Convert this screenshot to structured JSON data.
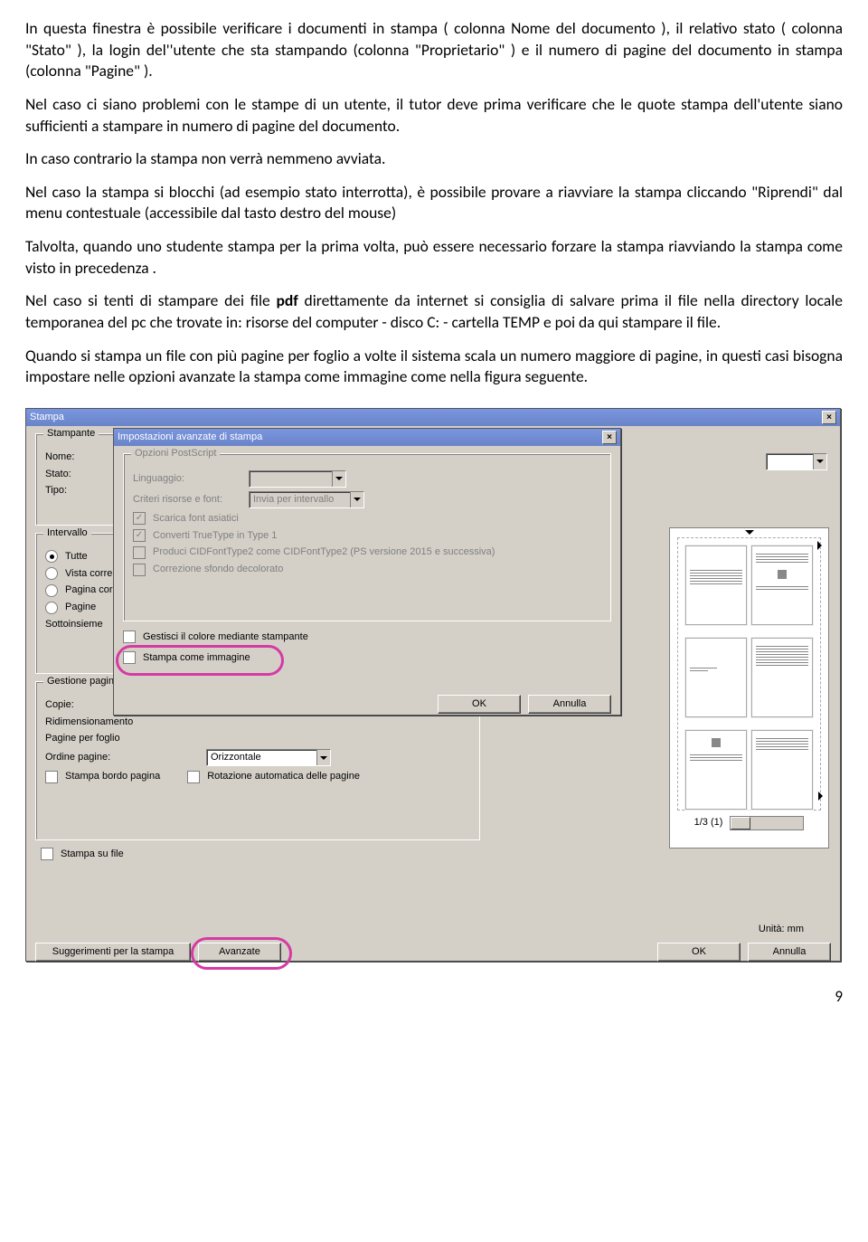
{
  "paragraphs": {
    "p1": "In questa finestra è possibile verificare i documenti in stampa ( colonna Nome del documento ), il relativo stato ( colonna \"Stato\" ), la login del''utente che sta stampando (colonna \"Proprietario\" ) e il numero di pagine del documento in stampa (colonna \"Pagine\" ).",
    "p2": "Nel caso ci siano problemi con le stampe di un utente, il tutor deve prima verificare che le quote stampa dell'utente siano sufficienti a stampare in numero di pagine del documento.",
    "p3": "In caso contrario la stampa non verrà nemmeno avviata.",
    "p4a": "Nel caso la stampa si blocchi (ad esempio  stato interrotta), è possibile provare a riavviare la stampa cliccando \"Riprendi\" dal menu contestuale (accessibile dal tasto destro del mouse)",
    "p5": "Talvolta, quando uno studente stampa per la prima volta, può essere necessario forzare la stampa riavviando la stampa come visto in precedenza .",
    "p6a": "Nel caso si tenti di stampare dei file ",
    "p6b": "pdf",
    "p6c": " direttamente da internet si consiglia di salvare prima il file nella directory locale temporanea del pc che trovate in: risorse del computer - disco C: -  cartella TEMP e poi da qui stampare il file.",
    "p7": "Quando si stampa un file con più pagine per foglio a volte il sistema scala un numero maggiore di pagine, in questi casi bisogna impostare nelle opzioni avanzate la stampa come immagine come nella figura seguente."
  },
  "dlg": {
    "stampa_title": "Stampa",
    "adv_title": "Impostazioni avanzate di stampa",
    "groups": {
      "stampante": "Stampante",
      "intervallo": "Intervallo",
      "gestione": "Gestione pagina",
      "ps": "Opzioni PostScript"
    },
    "labels": {
      "nome": "Nome:",
      "stato": "Stato:",
      "tipo": "Tipo:",
      "tutte": "Tutte",
      "vista": "Vista corrente",
      "pagina": "Pagina corrente",
      "pagine": "Pagine",
      "sottoins": "Sottoinsieme",
      "copie": "Copie:",
      "ridim": "Ridimensionamento",
      "pagineper": "Pagine per foglio",
      "ordine": "Ordine pagine:",
      "bordo": "Stampa bordo pagina",
      "rotauto": "Rotazione automatica delle pagine",
      "stampafile": "Stampa su file",
      "ordine_val": "Orizzontale",
      "linguaggio": "Linguaggio:",
      "criteri": "Criteri risorse e font:",
      "criteri_val": "Invia per intervallo",
      "scarica": "Scarica font asiatici",
      "truetype": "Converti TrueType in Type 1",
      "cid": "Produci CIDFontType2 come CIDFontType2 (PS versione 2015 e successiva)",
      "sfondo": "Correzione sfondo decolorato",
      "gestcolor": "Gestisci il colore mediante stampante",
      "stampaimg": "Stampa come immagine",
      "ok": "OK",
      "annulla": "Annulla",
      "sugger": "Suggerimenti per la stampa",
      "avanzate": "Avanzate",
      "unita": "Unità: mm",
      "pager": "1/3 (1)"
    }
  },
  "page_number": "9"
}
